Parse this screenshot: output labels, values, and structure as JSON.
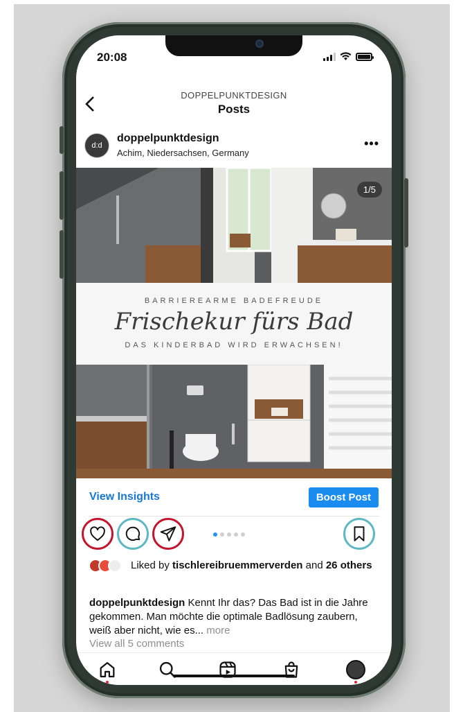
{
  "status": {
    "time": "20:08"
  },
  "header": {
    "username": "DOPPELPUNKTDESIGN",
    "title": "Posts",
    "back_icon": "chevron-left-icon"
  },
  "post": {
    "avatar_text": "d:d",
    "username": "doppelpunktdesign",
    "location": "Achim, Niedersachsen, Germany",
    "more_icon": "more-horizontal-icon",
    "media": {
      "counter": "1/5",
      "band_top": "BARRIEREARME BADEFREUDE",
      "band_script": "Frischekur fürs Bad",
      "band_bottom": "DAS KINDERBAD WIRD ERWACHSEN!"
    },
    "view_insights": "View Insights",
    "boost_post": "Boost Post",
    "carousel": {
      "count": 5,
      "active": 1
    },
    "liked_prefix": "Liked by ",
    "liked_user": "tischlereibruemmerverden",
    "liked_middle": " and ",
    "liked_count": "26 others",
    "caption_user": "doppelpunktdesign",
    "caption_text": " Kennt Ihr das? Das Bad ist in die Jahre gekommen.  Man möchte die optimale Badlösung zaubern, weiß aber nicht, wie es...",
    "caption_more": " more",
    "view_comments": "View all 5 comments"
  },
  "actions": {
    "like_icon": "heart-icon",
    "comment_icon": "comment-icon",
    "share_icon": "send-icon",
    "save_icon": "bookmark-icon",
    "highlight_red": "#c0162e",
    "highlight_teal": "#5fb7c4"
  },
  "nav": {
    "icons": [
      "home-icon",
      "search-icon",
      "reels-icon",
      "shop-icon",
      "profile-avatar"
    ]
  },
  "colors": {
    "accent": "#1a8cf0",
    "link": "#1877d2",
    "notification": "#e0243b"
  }
}
